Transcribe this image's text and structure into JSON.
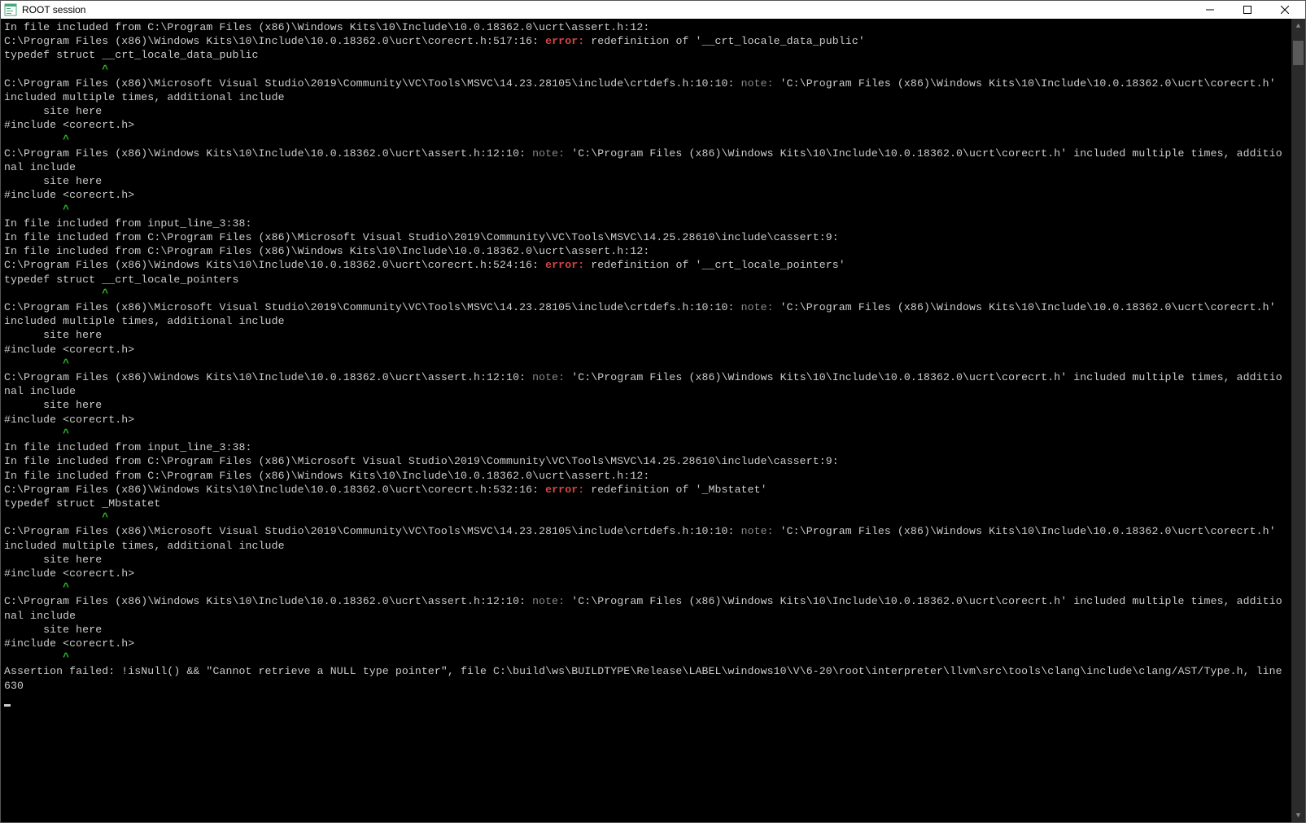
{
  "window": {
    "title": "ROOT session",
    "controls": {
      "minimize": "minimize",
      "maximize": "maximize",
      "close": "close"
    }
  },
  "colors": {
    "error": "#d64545",
    "note": "#888888",
    "caret": "#2dbf2d",
    "text": "#cccccc",
    "bg": "#000000"
  },
  "terminal": {
    "lines": [
      [
        {
          "t": "In file included from C:\\Program Files (x86)\\Windows Kits\\10\\Include\\10.0.18362.0\\ucrt\\assert.h:12:"
        }
      ],
      [
        {
          "t": "C:\\Program Files (x86)\\Windows Kits\\10\\Include\\10.0.18362.0\\ucrt\\corecrt.h:517:16: "
        },
        {
          "t": "error:",
          "c": "err"
        },
        {
          "t": " redefinition of '__crt_locale_data_public'"
        }
      ],
      [
        {
          "t": "typedef struct __crt_locale_data_public"
        }
      ],
      [
        {
          "t": "               "
        },
        {
          "t": "^",
          "c": "caret"
        }
      ],
      [
        {
          "t": "C:\\Program Files (x86)\\Microsoft Visual Studio\\2019\\Community\\VC\\Tools\\MSVC\\14.23.28105\\include\\crtdefs.h:10:10: "
        },
        {
          "t": "note:",
          "c": "note"
        },
        {
          "t": " 'C:\\Program Files (x86)\\Windows Kits\\10\\Include\\10.0.18362.0\\ucrt\\corecrt.h' included multiple times, additional include"
        }
      ],
      [
        {
          "t": "      site here"
        }
      ],
      [
        {
          "t": "#include <corecrt.h>"
        }
      ],
      [
        {
          "t": "         "
        },
        {
          "t": "^",
          "c": "caret"
        }
      ],
      [
        {
          "t": "C:\\Program Files (x86)\\Windows Kits\\10\\Include\\10.0.18362.0\\ucrt\\assert.h:12:10: "
        },
        {
          "t": "note:",
          "c": "note"
        },
        {
          "t": " 'C:\\Program Files (x86)\\Windows Kits\\10\\Include\\10.0.18362.0\\ucrt\\corecrt.h' included multiple times, additional include"
        }
      ],
      [
        {
          "t": "      site here"
        }
      ],
      [
        {
          "t": "#include <corecrt.h>"
        }
      ],
      [
        {
          "t": "         "
        },
        {
          "t": "^",
          "c": "caret"
        }
      ],
      [
        {
          "t": "In file included from input_line_3:38:"
        }
      ],
      [
        {
          "t": "In file included from C:\\Program Files (x86)\\Microsoft Visual Studio\\2019\\Community\\VC\\Tools\\MSVC\\14.25.28610\\include\\cassert:9:"
        }
      ],
      [
        {
          "t": "In file included from C:\\Program Files (x86)\\Windows Kits\\10\\Include\\10.0.18362.0\\ucrt\\assert.h:12:"
        }
      ],
      [
        {
          "t": "C:\\Program Files (x86)\\Windows Kits\\10\\Include\\10.0.18362.0\\ucrt\\corecrt.h:524:16: "
        },
        {
          "t": "error:",
          "c": "err"
        },
        {
          "t": " redefinition of '__crt_locale_pointers'"
        }
      ],
      [
        {
          "t": "typedef struct __crt_locale_pointers"
        }
      ],
      [
        {
          "t": "               "
        },
        {
          "t": "^",
          "c": "caret"
        }
      ],
      [
        {
          "t": "C:\\Program Files (x86)\\Microsoft Visual Studio\\2019\\Community\\VC\\Tools\\MSVC\\14.23.28105\\include\\crtdefs.h:10:10: "
        },
        {
          "t": "note:",
          "c": "note"
        },
        {
          "t": " 'C:\\Program Files (x86)\\Windows Kits\\10\\Include\\10.0.18362.0\\ucrt\\corecrt.h' included multiple times, additional include"
        }
      ],
      [
        {
          "t": "      site here"
        }
      ],
      [
        {
          "t": "#include <corecrt.h>"
        }
      ],
      [
        {
          "t": "         "
        },
        {
          "t": "^",
          "c": "caret"
        }
      ],
      [
        {
          "t": "C:\\Program Files (x86)\\Windows Kits\\10\\Include\\10.0.18362.0\\ucrt\\assert.h:12:10: "
        },
        {
          "t": "note:",
          "c": "note"
        },
        {
          "t": " 'C:\\Program Files (x86)\\Windows Kits\\10\\Include\\10.0.18362.0\\ucrt\\corecrt.h' included multiple times, additional include"
        }
      ],
      [
        {
          "t": "      site here"
        }
      ],
      [
        {
          "t": "#include <corecrt.h>"
        }
      ],
      [
        {
          "t": "         "
        },
        {
          "t": "^",
          "c": "caret"
        }
      ],
      [
        {
          "t": "In file included from input_line_3:38:"
        }
      ],
      [
        {
          "t": "In file included from C:\\Program Files (x86)\\Microsoft Visual Studio\\2019\\Community\\VC\\Tools\\MSVC\\14.25.28610\\include\\cassert:9:"
        }
      ],
      [
        {
          "t": "In file included from C:\\Program Files (x86)\\Windows Kits\\10\\Include\\10.0.18362.0\\ucrt\\assert.h:12:"
        }
      ],
      [
        {
          "t": "C:\\Program Files (x86)\\Windows Kits\\10\\Include\\10.0.18362.0\\ucrt\\corecrt.h:532:16: "
        },
        {
          "t": "error:",
          "c": "err"
        },
        {
          "t": " redefinition of '_Mbstatet'"
        }
      ],
      [
        {
          "t": "typedef struct _Mbstatet"
        }
      ],
      [
        {
          "t": "               "
        },
        {
          "t": "^",
          "c": "caret"
        }
      ],
      [
        {
          "t": "C:\\Program Files (x86)\\Microsoft Visual Studio\\2019\\Community\\VC\\Tools\\MSVC\\14.23.28105\\include\\crtdefs.h:10:10: "
        },
        {
          "t": "note:",
          "c": "note"
        },
        {
          "t": " 'C:\\Program Files (x86)\\Windows Kits\\10\\Include\\10.0.18362.0\\ucrt\\corecrt.h' included multiple times, additional include"
        }
      ],
      [
        {
          "t": "      site here"
        }
      ],
      [
        {
          "t": "#include <corecrt.h>"
        }
      ],
      [
        {
          "t": "         "
        },
        {
          "t": "^",
          "c": "caret"
        }
      ],
      [
        {
          "t": "C:\\Program Files (x86)\\Windows Kits\\10\\Include\\10.0.18362.0\\ucrt\\assert.h:12:10: "
        },
        {
          "t": "note:",
          "c": "note"
        },
        {
          "t": " 'C:\\Program Files (x86)\\Windows Kits\\10\\Include\\10.0.18362.0\\ucrt\\corecrt.h' included multiple times, additional include"
        }
      ],
      [
        {
          "t": "      site here"
        }
      ],
      [
        {
          "t": "#include <corecrt.h>"
        }
      ],
      [
        {
          "t": "         "
        },
        {
          "t": "^",
          "c": "caret"
        }
      ],
      [
        {
          "t": "Assertion failed: !isNull() && \"Cannot retrieve a NULL type pointer\", file C:\\build\\ws\\BUILDTYPE\\Release\\LABEL\\windows10\\V\\6-20\\root\\interpreter\\llvm\\src\\tools\\clang\\include\\clang/AST/Type.h, line 630"
        }
      ]
    ]
  }
}
